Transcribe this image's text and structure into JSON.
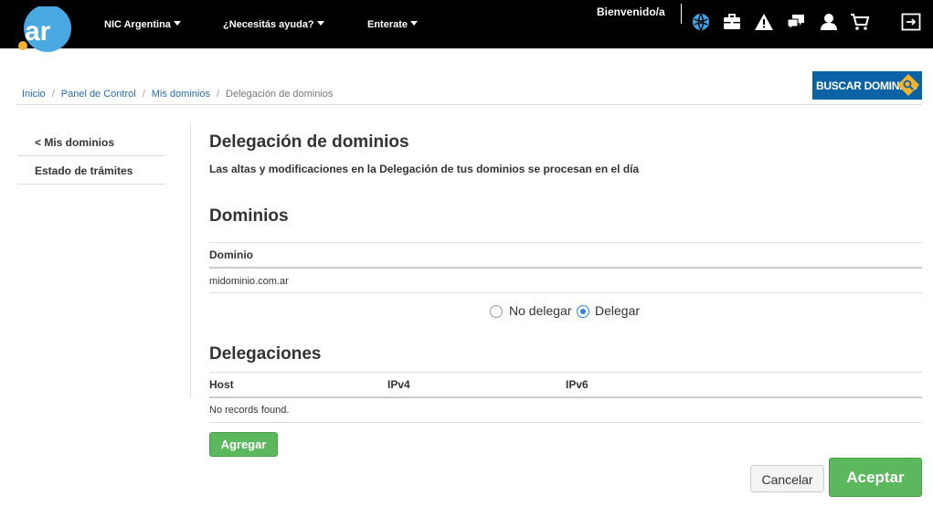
{
  "header": {
    "logo_text": ".ar",
    "nav": [
      {
        "label": "NIC Argentina"
      },
      {
        "label": "¿Necesitás ayuda?"
      },
      {
        "label": "Enterate"
      }
    ],
    "welcome": "Bienvenido/a",
    "icons": [
      "globe-icon",
      "briefcase-icon",
      "warning-icon",
      "chat-icon",
      "user-icon",
      "cart-icon",
      "logout-icon"
    ]
  },
  "breadcrumb": [
    {
      "label": "Inicio"
    },
    {
      "label": "Panel de Control"
    },
    {
      "label": "Mis dominios"
    },
    {
      "label": "Delegación de dominios"
    }
  ],
  "buscar_dominios": "BUSCAR DOMINIOS",
  "sidebar": {
    "items": [
      {
        "label": "< Mis dominios"
      },
      {
        "label": "Estado de trámites"
      }
    ]
  },
  "main": {
    "title": "Delegación de dominios",
    "subtitle": "Las altas y modificaciones en la Delegación de tus dominios se procesan en el día",
    "dominios": {
      "heading": "Dominios",
      "column": "Dominio",
      "rows": [
        "midominio.com.ar"
      ]
    },
    "radio": {
      "options": [
        "No delegar",
        "Delegar"
      ],
      "selected": "Delegar"
    },
    "delegaciones": {
      "heading": "Delegaciones",
      "columns": [
        "Host",
        "IPv4",
        "IPv6"
      ],
      "empty": "No records found."
    },
    "add_button": "Agregar"
  },
  "footer_buttons": {
    "cancel": "Cancelar",
    "accept": "Aceptar"
  },
  "colors": {
    "topbar": "#000000",
    "link": "#2a6db3",
    "primary_green": "#5cb85c",
    "brand_blue": "#0b63a6",
    "accent_yellow": "#f2b22e"
  }
}
